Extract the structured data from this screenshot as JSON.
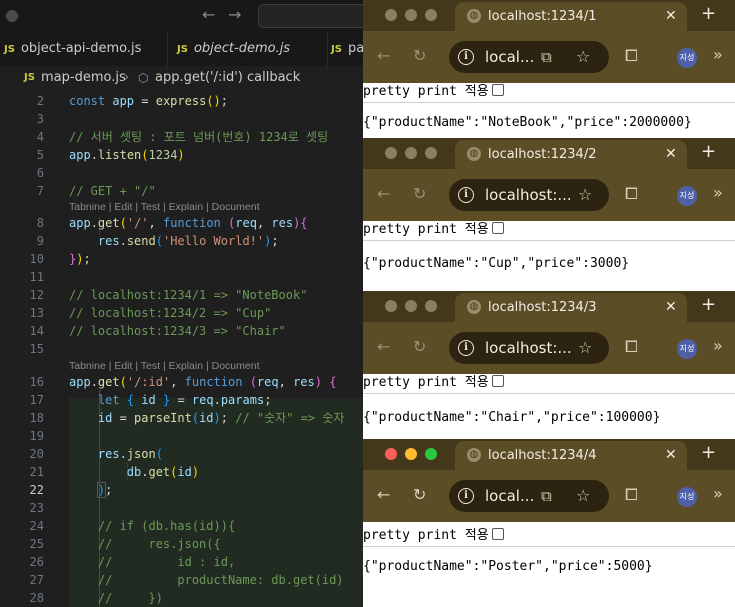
{
  "editor": {
    "tabs": [
      {
        "label": "object-api-demo.js",
        "icon": "JS"
      },
      {
        "label": "object-demo.js",
        "icon": "JS"
      },
      {
        "label": "pa",
        "icon": "JS"
      }
    ],
    "breadcrumb": {
      "file": "map-demo.js",
      "symbol": "app.get('/:id') callback"
    },
    "codelens": "Tabnine | Edit | Test | Explain | Document",
    "active_line": "22",
    "lines": [
      {
        "n": "2",
        "code": "const app = express();"
      },
      {
        "n": "3",
        "code": ""
      },
      {
        "n": "4",
        "code": "// 서버 셋팅 : 포트 넘버(번호) 1234로 셋팅"
      },
      {
        "n": "5",
        "code": "app.listen(1234)"
      },
      {
        "n": "6",
        "code": ""
      },
      {
        "n": "7",
        "code": "// GET + \"/\""
      },
      {
        "n": "8",
        "code": "app.get('/', function (req, res){"
      },
      {
        "n": "9",
        "code": "    res.send('Hello World!');"
      },
      {
        "n": "10",
        "code": "});"
      },
      {
        "n": "11",
        "code": ""
      },
      {
        "n": "12",
        "code": "// localhost:1234/1 => \"NoteBook\""
      },
      {
        "n": "13",
        "code": "// localhost:1234/2 => \"Cup\""
      },
      {
        "n": "14",
        "code": "// localhost:1234/3 => \"Chair\""
      },
      {
        "n": "15",
        "code": ""
      },
      {
        "n": "16",
        "code": "app.get('/:id', function (req, res) {"
      },
      {
        "n": "17",
        "code": "    let { id } = req.params;"
      },
      {
        "n": "18",
        "code": "    id = parseInt(id); // \"숫자\" => 숫자"
      },
      {
        "n": "19",
        "code": ""
      },
      {
        "n": "20",
        "code": "    res.json("
      },
      {
        "n": "21",
        "code": "        db.get(id)"
      },
      {
        "n": "22",
        "code": "    );"
      },
      {
        "n": "23",
        "code": ""
      },
      {
        "n": "24",
        "code": "    // if (db.has(id)){"
      },
      {
        "n": "25",
        "code": "    //     res.json({"
      },
      {
        "n": "26",
        "code": "    //         id : id,"
      },
      {
        "n": "27",
        "code": "    //         productName: db.get(id)"
      },
      {
        "n": "28",
        "code": "    //     })"
      }
    ]
  },
  "browsers": [
    {
      "tab_title": "localhost:1234/1",
      "url": "local...",
      "pretty_print": "pretty print 적용",
      "json": "{\"productName\":\"NoteBook\",\"price\":2000000}",
      "avatar": "지성",
      "focused": false
    },
    {
      "tab_title": "localhost:1234/2",
      "url": "localhost:...",
      "pretty_print": "pretty print 적용",
      "json": "{\"productName\":\"Cup\",\"price\":3000}",
      "avatar": "지성",
      "focused": false
    },
    {
      "tab_title": "localhost:1234/3",
      "url": "localhost:...",
      "pretty_print": "pretty print 적용",
      "json": "{\"productName\":\"Chair\",\"price\":100000}",
      "avatar": "지성",
      "focused": false
    },
    {
      "tab_title": "localhost:1234/4",
      "url": "local...",
      "pretty_print": "pretty print 적용",
      "json": "{\"productName\":\"Poster\",\"price\":5000}",
      "avatar": "지성",
      "focused": true
    }
  ],
  "colors": {
    "browser_frame": "#43391a",
    "browser_toolbar": "#5b4d26",
    "editor_bg": "#1f1f1f"
  }
}
